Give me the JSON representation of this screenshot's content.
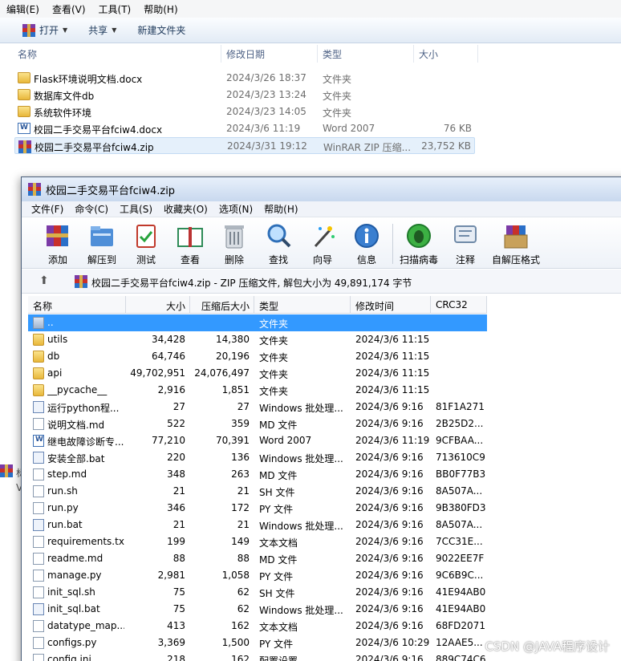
{
  "explorer": {
    "menu": [
      "编辑(E)",
      "查看(V)",
      "工具(T)",
      "帮助(H)"
    ],
    "toolbar": {
      "open": "打开",
      "share": "共享",
      "new_folder": "新建文件夹"
    },
    "columns": {
      "name": "名称",
      "modified": "修改日期",
      "type": "类型",
      "size": "大小"
    },
    "files": [
      {
        "name": "Flask环境说明文档.docx",
        "modified": "2024/3/26 18:37",
        "type": "文件夹",
        "size": "",
        "icon": "folder-icon"
      },
      {
        "name": "数据库文件db",
        "modified": "2024/3/23 13:24",
        "type": "文件夹",
        "size": "",
        "icon": "folder-icon"
      },
      {
        "name": "系统软件环境",
        "modified": "2024/3/23 14:05",
        "type": "文件夹",
        "size": "",
        "icon": "folder-icon"
      },
      {
        "name": "校园二手交易平台fciw4.docx",
        "modified": "2024/3/6 11:19",
        "type": "Word 2007",
        "size": "76 KB",
        "icon": "word-doc-icon"
      },
      {
        "name": "校园二手交易平台fciw4.zip",
        "modified": "2024/3/31 19:12",
        "type": "WinRAR ZIP 压缩...",
        "size": "23,752 KB",
        "icon": "winrar-icon"
      }
    ],
    "left_strip": [
      "标",
      "V"
    ]
  },
  "winrar": {
    "title": "校园二手交易平台fciw4.zip",
    "menu": [
      "文件(F)",
      "命令(C)",
      "工具(S)",
      "收藏夹(O)",
      "选项(N)",
      "帮助(H)"
    ],
    "tools": [
      {
        "label": "添加",
        "icon": "add-archive-icon"
      },
      {
        "label": "解压到",
        "icon": "extract-to-icon"
      },
      {
        "label": "测试",
        "icon": "test-icon"
      },
      {
        "label": "查看",
        "icon": "view-icon"
      },
      {
        "label": "删除",
        "icon": "delete-icon"
      },
      {
        "label": "查找",
        "icon": "find-icon"
      },
      {
        "label": "向导",
        "icon": "wizard-icon"
      },
      {
        "label": "信息",
        "icon": "info-icon"
      },
      {
        "label": "扫描病毒",
        "icon": "virus-scan-icon"
      },
      {
        "label": "注释",
        "icon": "comment-icon"
      },
      {
        "label": "自解压格式",
        "icon": "sfx-icon"
      }
    ],
    "address": "校园二手交易平台fciw4.zip - ZIP 压缩文件, 解包大小为 49,891,174 字节",
    "columns": {
      "name": "名称",
      "size": "大小",
      "packed": "压缩后大小",
      "type": "类型",
      "modified": "修改时间",
      "crc": "CRC32"
    },
    "rows": [
      {
        "name": "..",
        "size": "",
        "packed": "",
        "type": "文件夹",
        "modified": "",
        "crc": "",
        "icon": "up-folder-icon",
        "selected": true
      },
      {
        "name": "utils",
        "size": "34,428",
        "packed": "14,380",
        "type": "文件夹",
        "modified": "2024/3/6 11:15",
        "crc": "",
        "icon": "folder-icon"
      },
      {
        "name": "db",
        "size": "64,746",
        "packed": "20,196",
        "type": "文件夹",
        "modified": "2024/3/6 11:15",
        "crc": "",
        "icon": "folder-icon"
      },
      {
        "name": "api",
        "size": "49,702,951",
        "packed": "24,076,497",
        "type": "文件夹",
        "modified": "2024/3/6 11:15",
        "crc": "",
        "icon": "folder-icon"
      },
      {
        "name": "__pycache__",
        "size": "2,916",
        "packed": "1,851",
        "type": "文件夹",
        "modified": "2024/3/6 11:15",
        "crc": "",
        "icon": "folder-icon"
      },
      {
        "name": "运行python程...",
        "size": "27",
        "packed": "27",
        "type": "Windows 批处理...",
        "modified": "2024/3/6 9:16",
        "crc": "81F1A271",
        "icon": "batch-file-icon"
      },
      {
        "name": "说明文档.md",
        "size": "522",
        "packed": "359",
        "type": "MD 文件",
        "modified": "2024/3/6 9:16",
        "crc": "2B25D2...",
        "icon": "file-icon"
      },
      {
        "name": "继电故障诊断专...",
        "size": "77,210",
        "packed": "70,391",
        "type": "Word 2007",
        "modified": "2024/3/6 11:19",
        "crc": "9CFBAA...",
        "icon": "word-doc-icon"
      },
      {
        "name": "安装全部.bat",
        "size": "220",
        "packed": "136",
        "type": "Windows 批处理...",
        "modified": "2024/3/6 9:16",
        "crc": "713610C9",
        "icon": "batch-file-icon"
      },
      {
        "name": "step.md",
        "size": "348",
        "packed": "263",
        "type": "MD 文件",
        "modified": "2024/3/6 9:16",
        "crc": "BB0F77B3",
        "icon": "file-icon"
      },
      {
        "name": "run.sh",
        "size": "21",
        "packed": "21",
        "type": "SH 文件",
        "modified": "2024/3/6 9:16",
        "crc": "8A507A...",
        "icon": "file-icon"
      },
      {
        "name": "run.py",
        "size": "346",
        "packed": "172",
        "type": "PY 文件",
        "modified": "2024/3/6 9:16",
        "crc": "9B380FD3",
        "icon": "file-icon"
      },
      {
        "name": "run.bat",
        "size": "21",
        "packed": "21",
        "type": "Windows 批处理...",
        "modified": "2024/3/6 9:16",
        "crc": "8A507A...",
        "icon": "batch-file-icon"
      },
      {
        "name": "requirements.txt",
        "size": "199",
        "packed": "149",
        "type": "文本文档",
        "modified": "2024/3/6 9:16",
        "crc": "7CC31E...",
        "icon": "file-icon"
      },
      {
        "name": "readme.md",
        "size": "88",
        "packed": "88",
        "type": "MD 文件",
        "modified": "2024/3/6 9:16",
        "crc": "9022EE7F",
        "icon": "file-icon"
      },
      {
        "name": "manage.py",
        "size": "2,981",
        "packed": "1,058",
        "type": "PY 文件",
        "modified": "2024/3/6 9:16",
        "crc": "9C6B9C...",
        "icon": "file-icon"
      },
      {
        "name": "init_sql.sh",
        "size": "75",
        "packed": "62",
        "type": "SH 文件",
        "modified": "2024/3/6 9:16",
        "crc": "41E94AB0",
        "icon": "file-icon"
      },
      {
        "name": "init_sql.bat",
        "size": "75",
        "packed": "62",
        "type": "Windows 批处理...",
        "modified": "2024/3/6 9:16",
        "crc": "41E94AB0",
        "icon": "batch-file-icon"
      },
      {
        "name": "datatype_map....",
        "size": "413",
        "packed": "162",
        "type": "文本文档",
        "modified": "2024/3/6 9:16",
        "crc": "68FD2071",
        "icon": "file-icon"
      },
      {
        "name": "configs.py",
        "size": "3,369",
        "packed": "1,500",
        "type": "PY 文件",
        "modified": "2024/3/6 10:29",
        "crc": "12AAE5...",
        "icon": "file-icon"
      },
      {
        "name": "config.ini",
        "size": "218",
        "packed": "162",
        "type": "配置设置",
        "modified": "2024/3/6 9:16",
        "crc": "889C74C6",
        "icon": "file-icon"
      }
    ]
  },
  "watermark": "CSDN @JAVA程序设计",
  "colors": {
    "selection": "#3399ff",
    "explorer_selection": "#e5f0fb",
    "toolbar_text": "#1e395b"
  }
}
